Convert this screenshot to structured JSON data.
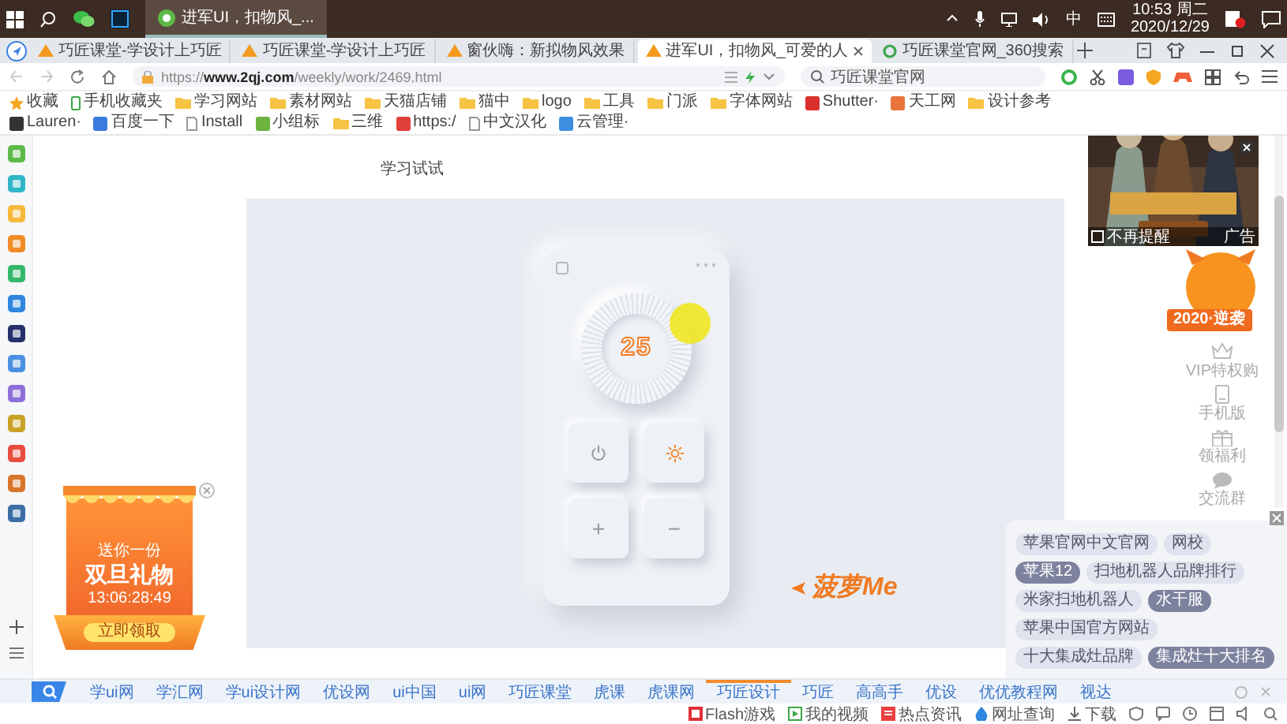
{
  "taskbar": {
    "active_window": "进军UI，扣物风_...",
    "input_method": "中",
    "time": "10:53 周二",
    "date": "2020/12/29"
  },
  "tabs": [
    {
      "label": "巧匠课堂-学设计上巧匠",
      "selected": false,
      "kind": "site"
    },
    {
      "label": "巧匠课堂-学设计上巧匠",
      "selected": false,
      "kind": "site"
    },
    {
      "label": "窗伙嗨：新拟物风效果",
      "selected": false,
      "kind": "site"
    },
    {
      "label": "进军UI，扣物风_可爱的人",
      "selected": true,
      "kind": "site"
    },
    {
      "label": "巧匠课堂官网_360搜索",
      "selected": false,
      "kind": "search"
    }
  ],
  "address_bar": {
    "url": "https://**www.2qj.com**/weekly/work/2469.html",
    "search": "巧匠课堂官网"
  },
  "bookmarks": [
    {
      "label": "收藏",
      "kind": "star"
    },
    {
      "label": "手机收藏夹",
      "kind": "mobile"
    },
    {
      "label": "学习网站",
      "kind": "folder"
    },
    {
      "label": "素材网站",
      "kind": "folder"
    },
    {
      "label": "天猫店铺",
      "kind": "folder"
    },
    {
      "label": "猫中",
      "kind": "folder"
    },
    {
      "label": "logo",
      "kind": "folder"
    },
    {
      "label": "工具",
      "kind": "folder"
    },
    {
      "label": "门派",
      "kind": "folder"
    },
    {
      "label": "字体网站",
      "kind": "folder"
    },
    {
      "label": "Shutter·",
      "kind": "site",
      "color": "#d9302c"
    },
    {
      "label": "天工网",
      "kind": "site",
      "color": "#e8743b"
    },
    {
      "label": "设计参考",
      "kind": "folder"
    },
    {
      "label": "Lauren·",
      "kind": "site",
      "color": "#333333"
    },
    {
      "label": "百度一下",
      "kind": "site",
      "color": "#3b7be0"
    },
    {
      "label": "Install",
      "kind": "page"
    },
    {
      "label": "小组标",
      "kind": "site",
      "color": "#6cb33f"
    },
    {
      "label": "三维",
      "kind": "folder"
    },
    {
      "label": "https:/",
      "kind": "site",
      "color": "#e0403a"
    },
    {
      "label": "中文汉化",
      "kind": "page"
    },
    {
      "label": "云管理·",
      "kind": "site",
      "color": "#3d8de0"
    }
  ],
  "page": {
    "heading": "学习试试",
    "artwork": {
      "reading": "25",
      "plus_key": "+",
      "minus_key": "−",
      "brand": "菠萝Me"
    }
  },
  "promo": {
    "line": "送你一份",
    "title": "双旦礼物",
    "countdown": "13:06:28:49",
    "button": "立即领取"
  },
  "ad": {
    "dismiss": {
      "label": "不再提醒",
      "checked": false
    },
    "tag": "广告"
  },
  "mascot": {
    "ribbon": "2020·逆袭"
  },
  "side_nav": [
    "VIP特权购",
    "手机版",
    "领福利",
    "交流群"
  ],
  "related_searches": [
    {
      "label": "苹果官网中文官网",
      "selected": false
    },
    {
      "label": "网校",
      "selected": false
    },
    {
      "label": "苹果12",
      "selected": true
    },
    {
      "label": "扫地机器人品牌排行",
      "selected": false
    },
    {
      "label": "米家扫地机器人",
      "selected": false
    },
    {
      "label": "水干服",
      "selected": true
    },
    {
      "label": "苹果中国官方网站",
      "selected": false
    },
    {
      "label": "十大集成灶品牌",
      "selected": false
    },
    {
      "label": "集成灶十大排名",
      "selected": true
    }
  ],
  "link_bar": [
    {
      "label": "学ui网",
      "selected": false
    },
    {
      "label": "学汇网",
      "selected": false
    },
    {
      "label": "学ui设计网",
      "selected": false
    },
    {
      "label": "优设网",
      "selected": false
    },
    {
      "label": "ui中国",
      "selected": false
    },
    {
      "label": "ui网",
      "selected": false
    },
    {
      "label": "巧匠课堂",
      "selected": false
    },
    {
      "label": "虎课",
      "selected": false
    },
    {
      "label": "虎课网",
      "selected": false
    },
    {
      "label": "巧匠设计",
      "selected": true
    },
    {
      "label": "巧匠",
      "selected": false
    },
    {
      "label": "高高手",
      "selected": false
    },
    {
      "label": "优设",
      "selected": false
    },
    {
      "label": "优优教程网",
      "selected": false
    },
    {
      "label": "视达",
      "selected": false
    }
  ],
  "status_bar": [
    {
      "label": "Flash游戏",
      "kind": "game"
    },
    {
      "label": "我的视频",
      "kind": "video"
    },
    {
      "label": "热点资讯",
      "kind": "news"
    },
    {
      "label": "网址查询",
      "kind": "drop"
    },
    {
      "label": "下载",
      "kind": "download"
    }
  ]
}
